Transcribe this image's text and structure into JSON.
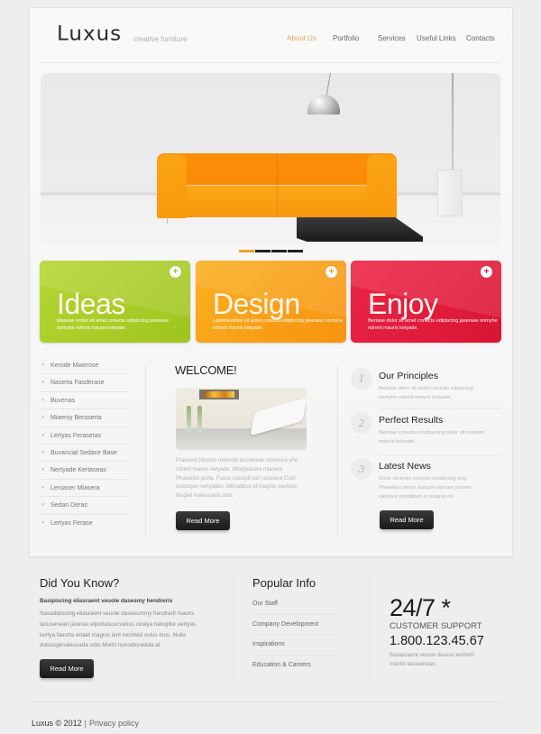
{
  "header": {
    "logo": "Luxus",
    "tagline": "creative furniture",
    "nav": [
      {
        "label": "About Us",
        "active": true
      },
      {
        "label": "Portfolio",
        "active": false
      },
      {
        "label": "Services",
        "active": false
      },
      {
        "label": "Useful Links",
        "active": false
      },
      {
        "label": "Contacts",
        "active": false
      }
    ]
  },
  "slider": {
    "image": "orange-sofa-interior",
    "slide_count": 4,
    "active_slide": 1
  },
  "features": [
    {
      "title": "Ideas",
      "text": "Maseas vrolor sit amet conectu sdipiscing jaserase onmyhe ndrent mauris ketyade.",
      "color": "#a8cb27",
      "icon": "plus-circle-icon"
    },
    {
      "title": "Design",
      "text": "Lasetrasdolor sit amet conectu edipiscing jaserase onmyhe ndrent mauris ketyade.",
      "color": "#f9a118",
      "icon": "plus-circle-icon"
    },
    {
      "title": "Enjoy",
      "text": "Bertase dolor sit amet conectu edipiscing jaserase onmyhe ndrent mauris ketyade.",
      "color": "#e21d3d",
      "icon": "plus-circle-icon"
    }
  ],
  "side_links": [
    "Kerode Miaerose",
    "Naserta Fasderase",
    "Buvenas",
    "Miaersy Beroserta",
    "Lertyas Ferasetas",
    "Buvancial Sedace Base",
    "Nertyade Kertaseas",
    "Leroaser Miasera",
    "Sedan Deras",
    "Lertyas Ferase"
  ],
  "welcome": {
    "title": "WELCOME!",
    "image": "white-lounge-chair-interior",
    "text": "Praesent tibulum molestie lacuenean nonmera yhe ndrent mauris ketyade. Mtaytyasera miasera Phasellus porta. Fusce suscipit vari usiasera Cum soatoque nertyades. Menatibus et magnis vaetuce feugiat malesuada odio.",
    "button": "Read More"
  },
  "principles": [
    {
      "num": "1",
      "title": "Our Principles",
      "text": "Bertase dolor sit amet conectu edipecing onmyhe ndrent mauris ketyade."
    },
    {
      "num": "2",
      "title": "Perfect Results",
      "text": "Bertase conectu eradipecing dolor sit ondrent mauris ketyade."
    },
    {
      "num": "3",
      "title": "Latest News",
      "text": "Dolor sit amet conectu eradiscing kety Phasellus porce suscipit varnum sociser natoque penatibus et magnis de."
    }
  ],
  "principles_button": "Read More",
  "did_you_know": {
    "title": "Did You Know?",
    "lead": "Basipiscing eliasraent veuole dasesmy hendreris",
    "text": "Nasadipiscing eliasraent veuole dasesummy hendrerit mauris lacusenean jaseras elportasuscvarius cinaya natogibe uertyas kertya faesrta ertaet magnis ient monteid culus mus. Nulla duiuscgimalesuada odio.Morbi nunodioravida at.",
    "button": "Read More"
  },
  "popular_info": {
    "title": "Popular Info",
    "links": [
      "Our Staff",
      "Company Development",
      "Inspirations",
      "Education & Careers"
    ]
  },
  "support": {
    "hours": "24/7 *",
    "label": "CUSTOMER SUPPORT",
    "phone": "1.800.123.45.67",
    "text": "Basiasraent veuole dasesu endrerit mauris lacusenean."
  },
  "footer": {
    "copyright": "Luxus © 2012",
    "separator": "|",
    "privacy": "Privacy policy"
  }
}
